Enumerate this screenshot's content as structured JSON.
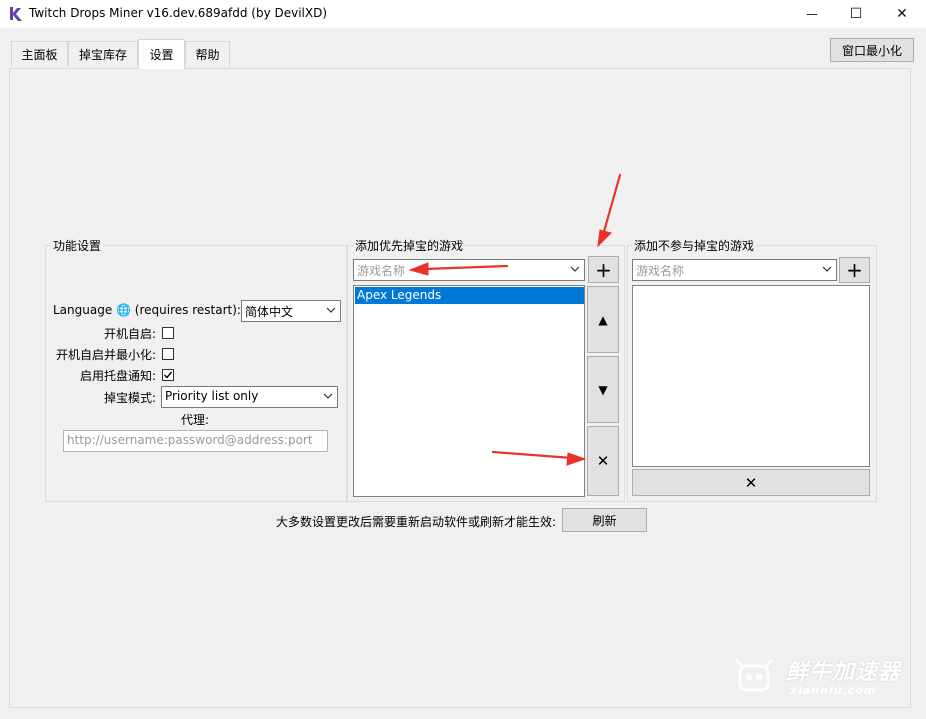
{
  "window": {
    "title": "Twitch Drops Miner v16.dev.689afdd (by DevilXD)",
    "minimize_glyph": "—",
    "maximize_glyph": "☐",
    "close_glyph": "✕"
  },
  "tabs": [
    {
      "label": "主面板"
    },
    {
      "label": "掉宝库存"
    },
    {
      "label": "设置",
      "active": true
    },
    {
      "label": "帮助"
    }
  ],
  "minimize_to_tray_button": "窗口最小化",
  "general": {
    "group_label": "功能设置",
    "language_label": "Language 🌐 (requires restart):",
    "language_value": "简体中文",
    "autostart_label": "开机自启:",
    "autostart_tray_label": "开机自启并最小化:",
    "tray_notifications_label": "启用托盘通知:",
    "tray_notifications_checked": true,
    "priority_mode_label": "掉宝模式:",
    "priority_mode_value": "Priority list only",
    "proxy_label": "代理:",
    "proxy_placeholder": "http://username:password@address:port"
  },
  "priority": {
    "group_label": "添加优先掉宝的游戏",
    "game_placeholder": "游戏名称",
    "add_glyph": "+",
    "items": [
      "Apex Legends"
    ],
    "up_glyph": "▲",
    "down_glyph": "▼",
    "delete_glyph": "✕"
  },
  "exclude": {
    "group_label": "添加不参与掉宝的游戏",
    "game_placeholder": "游戏名称",
    "add_glyph": "+",
    "delete_glyph": "✕"
  },
  "reload": {
    "note": "大多数设置更改后需要重新启动软件或刷新才能生效:",
    "button": "刷新"
  },
  "watermark": {
    "text": "鲜牛加速器",
    "sub": "xianniu.com"
  },
  "colors": {
    "selection": "#0078d7",
    "annotation_arrow": "#e8322a",
    "logo": "#6441a5"
  }
}
